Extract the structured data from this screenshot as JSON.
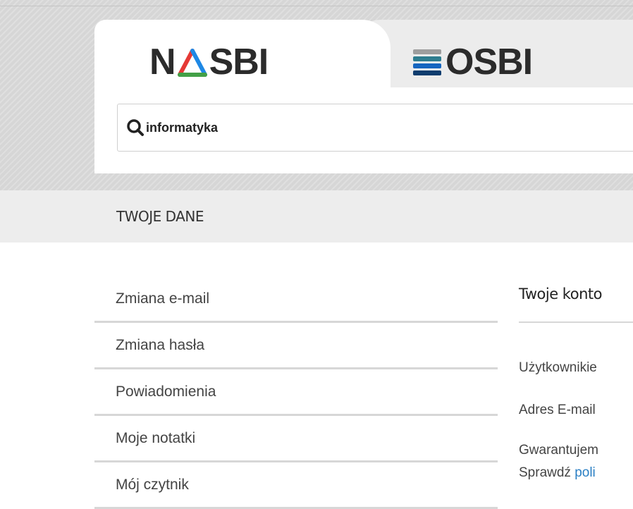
{
  "tabs": [
    {
      "label": "NASBI",
      "logo_text_before": "N",
      "logo_text_after": "SBI",
      "active": true
    },
    {
      "label": "OSBI",
      "logo_text": "OSBI",
      "active": false
    }
  ],
  "search": {
    "value": "informatyka",
    "icon": "search-icon"
  },
  "section": {
    "title": "TWOJE DANE"
  },
  "menu": {
    "items": [
      {
        "label": "Zmiana e-mail"
      },
      {
        "label": "Zmiana hasła"
      },
      {
        "label": "Powiadomienia"
      },
      {
        "label": "Moje notatki"
      },
      {
        "label": "Mój czytnik"
      }
    ]
  },
  "content": {
    "title": "Twoje konto",
    "lines": [
      {
        "text": "Użytkownikie"
      },
      {
        "text": "Adres E-mail"
      },
      {
        "text": "Gwarantujem"
      },
      {
        "text": "Sprawdź ",
        "link": "poli"
      }
    ]
  },
  "colors": {
    "accent_link": "#2a7fc4",
    "nasbi_triangle": [
      "#e53935",
      "#1e88e5",
      "#43a047"
    ],
    "osbi_stack": [
      "#9e9e9e",
      "#2e7d8f",
      "#1565c0",
      "#0d3c6e"
    ]
  }
}
